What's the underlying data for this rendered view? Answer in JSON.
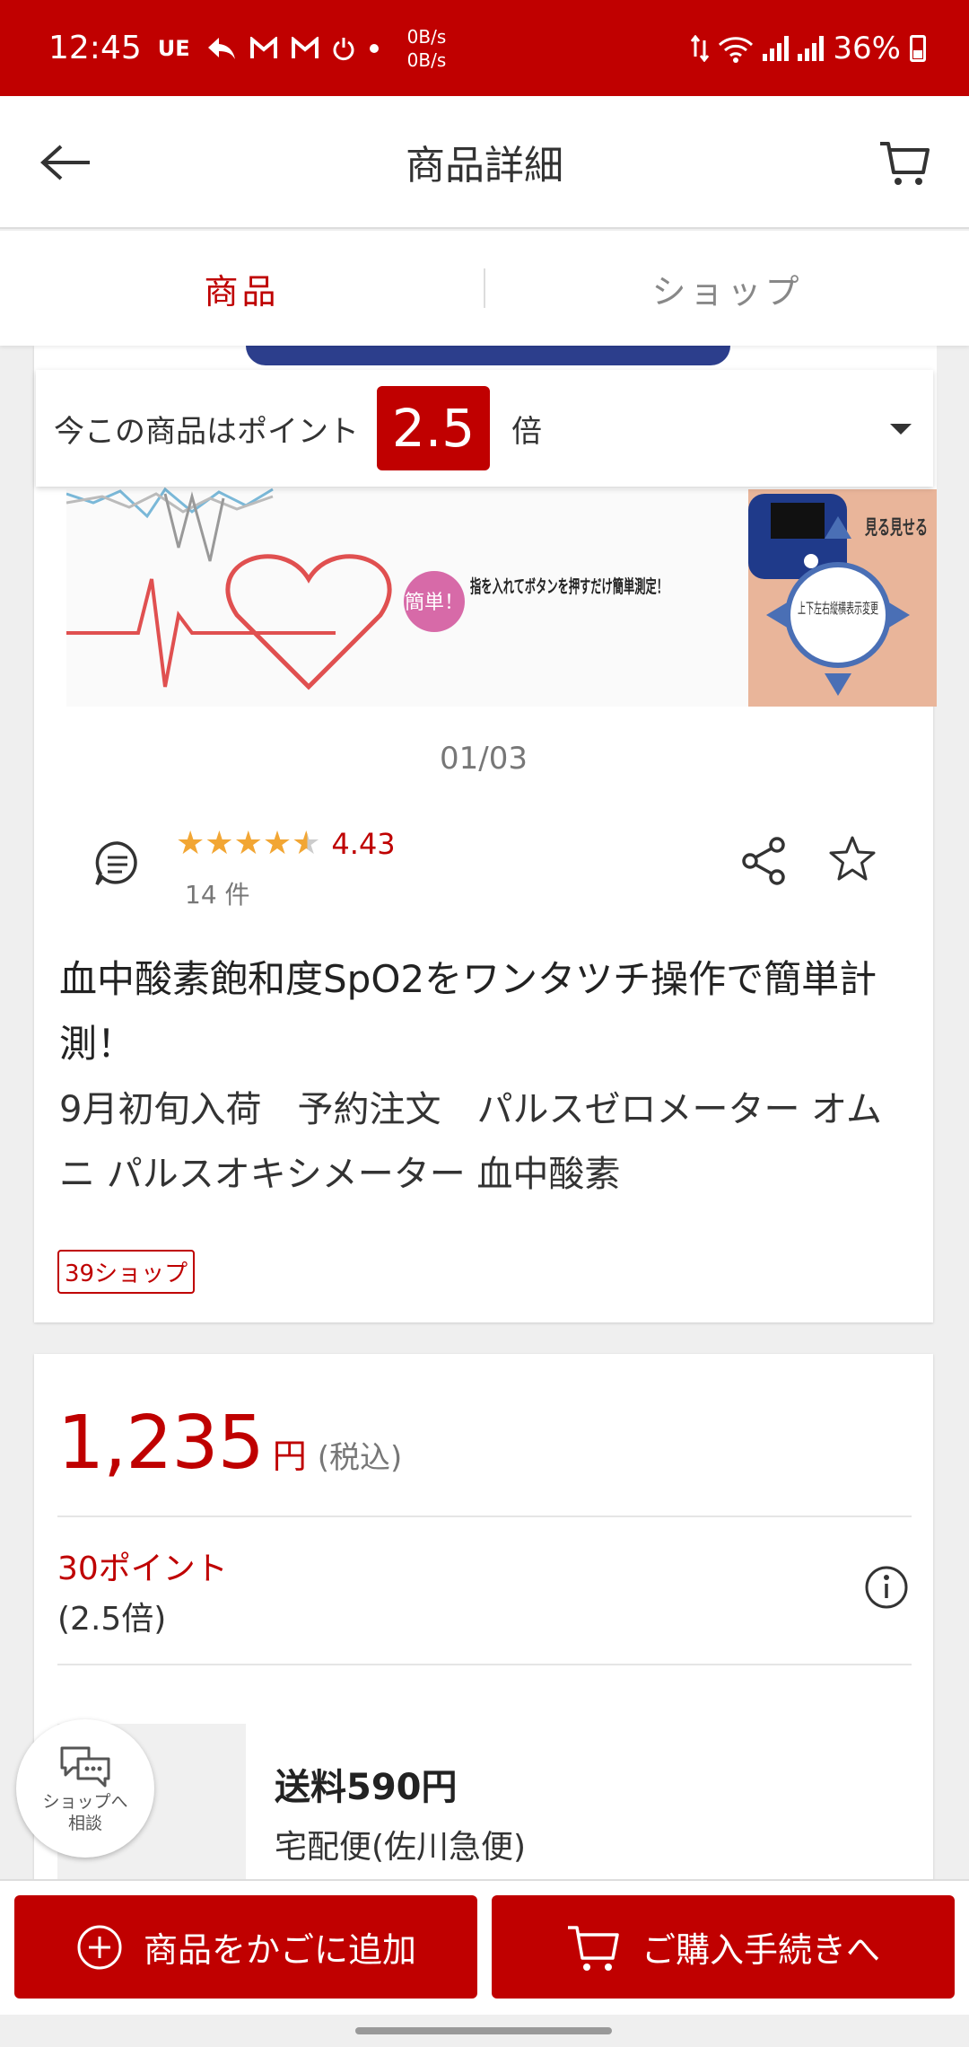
{
  "status_bar": {
    "time": "12:45",
    "carrier": "UE",
    "net_up": "0B/s",
    "net_down": "0B/s",
    "battery": "36%"
  },
  "header": {
    "title": "商品詳細"
  },
  "tabs": [
    {
      "label": "商品",
      "active": true
    },
    {
      "label": "ショップ",
      "active": false
    }
  ],
  "points_banner": {
    "prefix": "今この商品はポイント",
    "multiplier": "2.5",
    "suffix": "倍"
  },
  "gallery": {
    "indicator": "01/03",
    "image_text_1": "簡単！",
    "image_text_2": "指を入れてボタンを押すだけ簡単測定！",
    "image_text_3": "上下左右縦横表示変更",
    "image_text_4": "見る見せる"
  },
  "rating": {
    "score": "4.43",
    "stars": 4.43,
    "count": "14 件"
  },
  "product": {
    "catch_copy": "血中酸素飽和度SpO2をワンタツチ操作で簡単計測！",
    "name": "9月初旬入荷　予約注文　パルスゼロメーター オムニ パルスオキシメーター 血中酸素",
    "shop_badge": "39ショップ"
  },
  "price": {
    "amount": "1,235",
    "currency": "円",
    "tax_note": "(税込)"
  },
  "points": {
    "earn": "30ポイント",
    "rate": "(2.5倍)"
  },
  "shipping": {
    "fee": "送料590円",
    "method": "宅配便(佐川急便)"
  },
  "chat": {
    "line1": "ショップへ",
    "line2": "相談"
  },
  "actions": {
    "add_to_cart": "商品をかごに追加",
    "checkout": "ご購入手続きへ"
  },
  "colors": {
    "brand": "#c00000",
    "accent_text": "#bf0000",
    "star": "#f2a634"
  }
}
